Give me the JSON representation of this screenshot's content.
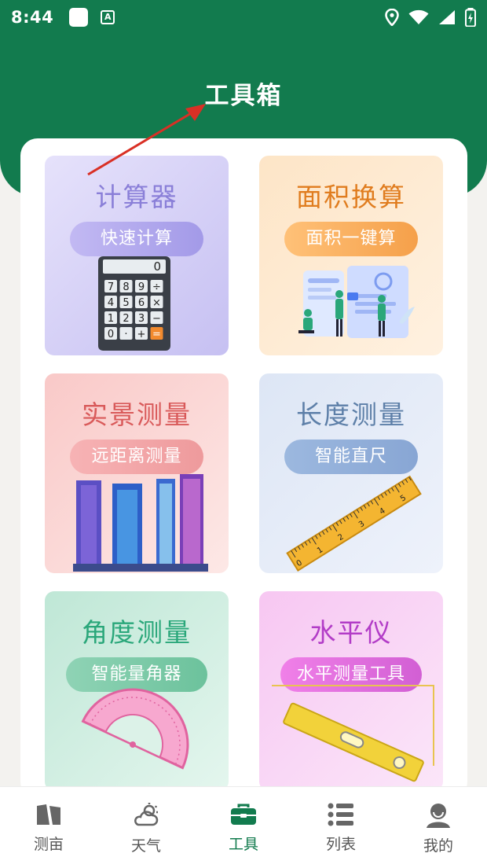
{
  "status_bar": {
    "time": "8:44"
  },
  "page_title": "工具箱",
  "tools": [
    {
      "title": "计算器",
      "subtitle": "快速计算",
      "title_color": "#8a7fd8"
    },
    {
      "title": "面积换算",
      "subtitle": "面积一键算",
      "title_color": "#e07c1e"
    },
    {
      "title": "实景测量",
      "subtitle": "远距离测量",
      "title_color": "#d95a5a"
    },
    {
      "title": "长度测量",
      "subtitle": "智能直尺",
      "title_color": "#5d7fa8"
    },
    {
      "title": "角度测量",
      "subtitle": "智能量角器",
      "title_color": "#2aa77a"
    },
    {
      "title": "水平仪",
      "subtitle": "水平测量工具",
      "title_color": "#b23cc7"
    }
  ],
  "calculator_display": "0",
  "calculator_keys": [
    "7",
    "8",
    "9",
    "÷",
    "4",
    "5",
    "6",
    "×",
    "1",
    "2",
    "3",
    "−",
    "0",
    "·",
    "+",
    "="
  ],
  "ruler_numbers": [
    "0",
    "1",
    "2",
    "3",
    "4",
    "5"
  ],
  "bottom_nav": [
    {
      "label": "测亩",
      "icon": "map-fold-icon"
    },
    {
      "label": "天气",
      "icon": "weather-icon"
    },
    {
      "label": "工具",
      "icon": "toolbox-icon",
      "active": true
    },
    {
      "label": "列表",
      "icon": "list-icon"
    },
    {
      "label": "我的",
      "icon": "profile-icon"
    }
  ],
  "colors": {
    "primary": "#127b4e",
    "arrow": "#d93025"
  }
}
